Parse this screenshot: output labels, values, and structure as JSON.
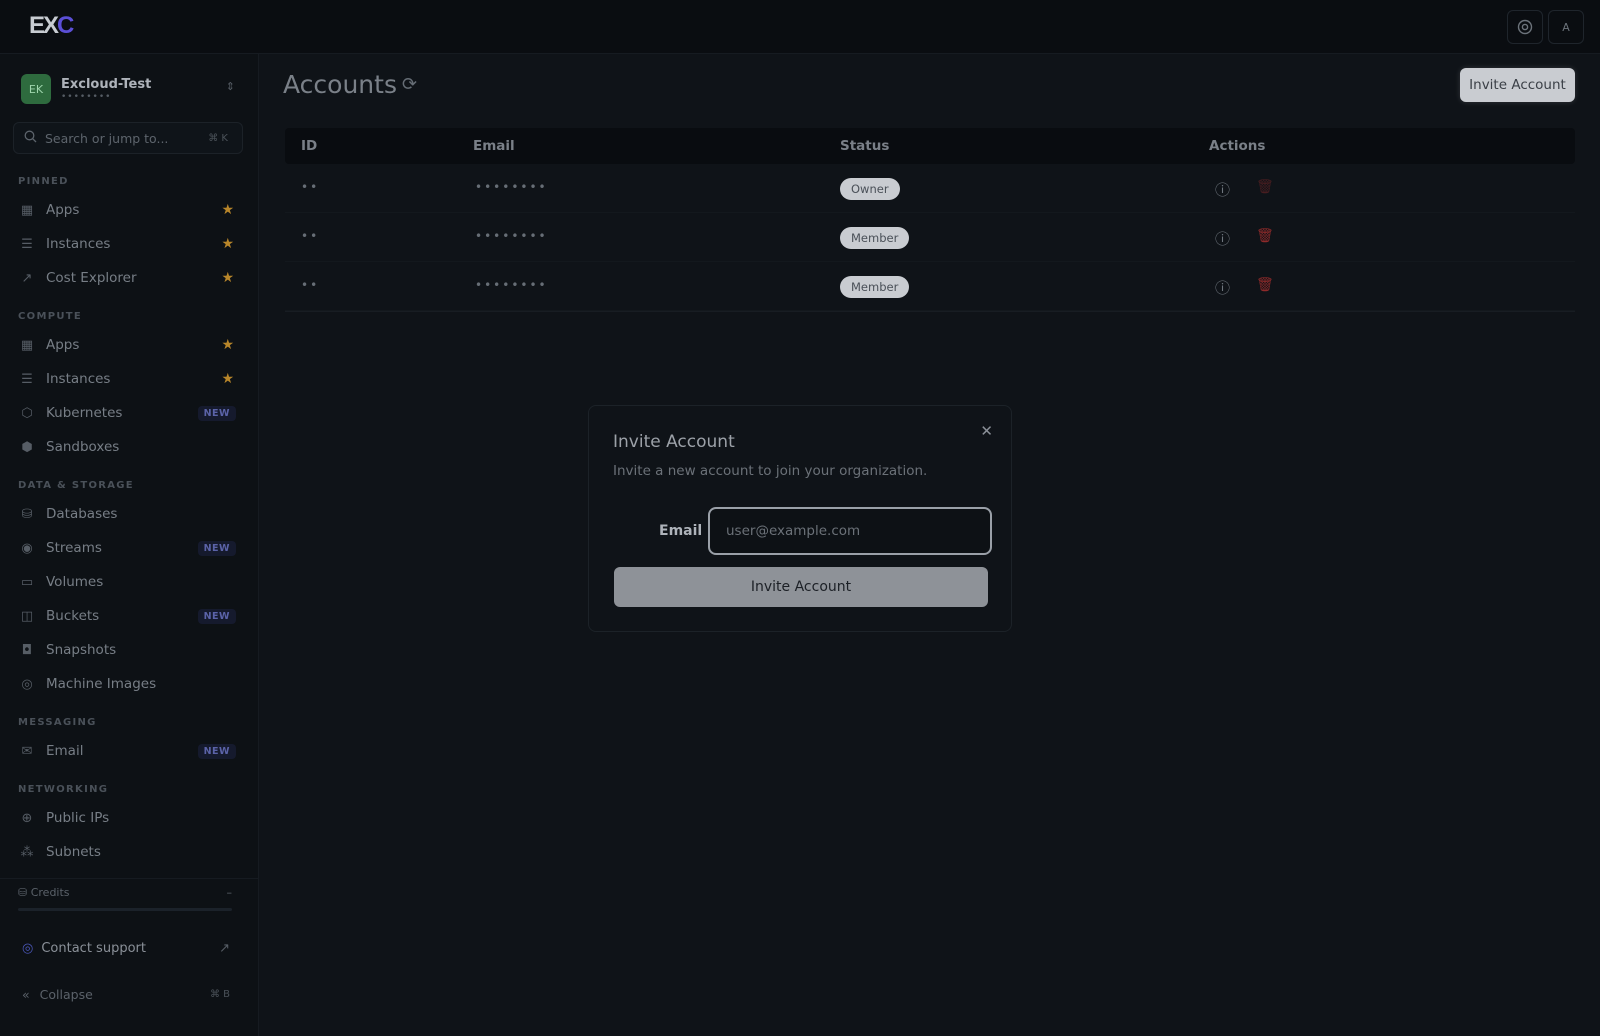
{
  "topbar": {
    "logo_main": "EX",
    "logo_accent": "C",
    "avatar_letter": "A"
  },
  "org": {
    "avatar": "EK",
    "name": "Excloud-Test",
    "sub": "••••••••"
  },
  "search": {
    "placeholder": "Search or jump to...",
    "shortcut": "⌘ K"
  },
  "sections": {
    "pinned": "PINNED",
    "compute": "COMPUTE",
    "data_storage": "DATA & STORAGE",
    "messaging": "MESSAGING",
    "networking": "NETWORKING"
  },
  "nav": {
    "pinned": [
      {
        "label": "Apps",
        "icon": "grid-icon"
      },
      {
        "label": "Instances",
        "icon": "server-icon"
      },
      {
        "label": "Cost Explorer",
        "icon": "trend-icon"
      }
    ],
    "compute": [
      {
        "label": "Apps",
        "icon": "grid-icon"
      },
      {
        "label": "Instances",
        "icon": "server-icon"
      },
      {
        "label": "Kubernetes",
        "icon": "hexagon-icon",
        "badge": "NEW"
      },
      {
        "label": "Sandboxes",
        "icon": "box-icon"
      }
    ],
    "data_storage": [
      {
        "label": "Databases",
        "icon": "database-icon"
      },
      {
        "label": "Streams",
        "icon": "radio-icon",
        "badge": "NEW"
      },
      {
        "label": "Volumes",
        "icon": "drive-icon"
      },
      {
        "label": "Buckets",
        "icon": "bucket-icon",
        "badge": "NEW"
      },
      {
        "label": "Snapshots",
        "icon": "camera-icon"
      },
      {
        "label": "Machine Images",
        "icon": "disc-icon"
      }
    ],
    "messaging": [
      {
        "label": "Email",
        "icon": "mail-icon",
        "badge": "NEW"
      }
    ],
    "networking": [
      {
        "label": "Public IPs",
        "icon": "globe-icon"
      },
      {
        "label": "Subnets",
        "icon": "network-icon"
      }
    ]
  },
  "sidebar_footer": {
    "credits": "Credits",
    "credits_value": "–",
    "contact": "Contact support",
    "collapse": "Collapse",
    "collapse_shortcut": "⌘ B"
  },
  "page": {
    "title": "Accounts",
    "invite_button": "Invite Account"
  },
  "table": {
    "headers": [
      "ID",
      "Email",
      "Status",
      "Actions"
    ],
    "rows": [
      {
        "id": "••",
        "email": "••••••••",
        "status": "Owner"
      },
      {
        "id": "••",
        "email": "••••••••",
        "status": "Member"
      },
      {
        "id": "••",
        "email": "••••••••",
        "status": "Member"
      }
    ]
  },
  "modal": {
    "title": "Invite Account",
    "description": "Invite a new account to join your organization.",
    "email_label": "Email",
    "email_placeholder": "user@example.com",
    "submit": "Invite Account"
  },
  "colors": {
    "star": "#b8862a",
    "delete": "#8e2a2a",
    "new_badge": "#5b63a8"
  }
}
